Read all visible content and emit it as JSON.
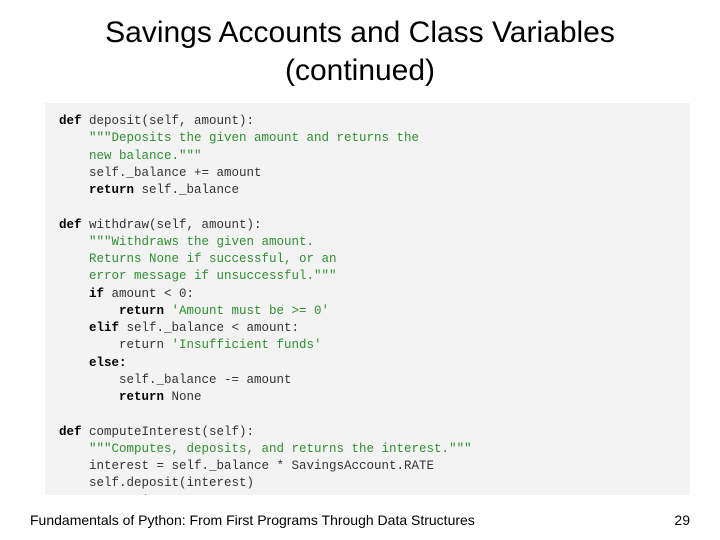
{
  "title_line1": "Savings Accounts and Class Variables",
  "title_line2": "(continued)",
  "code": {
    "l01a": "def",
    "l01b": " deposit(self, amount):",
    "l02": "    \"\"\"Deposits the given amount and returns the",
    "l03": "    new balance.\"\"\"",
    "l04": "    self._balance += amount",
    "l05a": "    ",
    "l05b": "return",
    "l05c": " self._balance",
    "l06": "",
    "l07a": "def",
    "l07b": " withdraw(self, amount):",
    "l08": "    \"\"\"Withdraws the given amount.",
    "l09": "    Returns None if successful, or an",
    "l10": "    error message if unsuccessful.\"\"\"",
    "l11a": "    ",
    "l11b": "if",
    "l11c": " amount < 0:",
    "l12a": "        ",
    "l12b": "return",
    "l12c": " 'Amount must be >= 0'",
    "l13a": "    ",
    "l13b": "elif",
    "l13c": " self._balance < amount:",
    "l14a": "        return ",
    "l14b": "'Insufficient funds'",
    "l15a": "    ",
    "l15b": "else:",
    "l16": "        self._balance -= amount",
    "l17a": "        ",
    "l17b": "return",
    "l17c": " None",
    "l18": "",
    "l19a": "def",
    "l19b": " computeInterest(self):",
    "l20": "    \"\"\"Computes, deposits, and returns the interest.\"\"\"",
    "l21": "    interest = self._balance * SavingsAccount.RATE",
    "l22": "    self.deposit(interest)",
    "l23a": "    ",
    "l23b": "return",
    "l23c": " interest"
  },
  "footer_text": "Fundamentals of Python: From First Programs Through Data Structures",
  "page_number": "29"
}
